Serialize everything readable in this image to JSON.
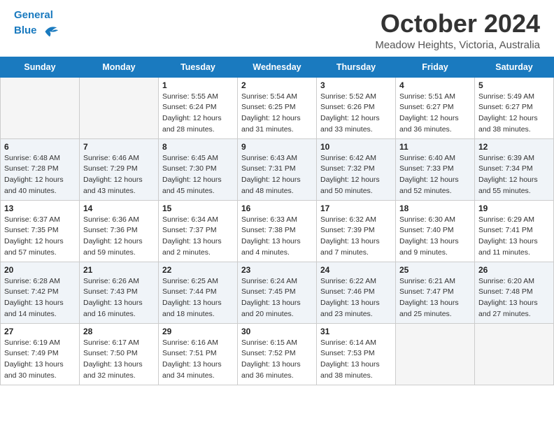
{
  "header": {
    "logo_line1": "General",
    "logo_line2": "Blue",
    "month_title": "October 2024",
    "location": "Meadow Heights, Victoria, Australia"
  },
  "days_of_week": [
    "Sunday",
    "Monday",
    "Tuesday",
    "Wednesday",
    "Thursday",
    "Friday",
    "Saturday"
  ],
  "weeks": [
    [
      {
        "day": "",
        "sunrise": "",
        "sunset": "",
        "daylight": "",
        "empty": true
      },
      {
        "day": "",
        "sunrise": "",
        "sunset": "",
        "daylight": "",
        "empty": true
      },
      {
        "day": "1",
        "sunrise": "Sunrise: 5:55 AM",
        "sunset": "Sunset: 6:24 PM",
        "daylight": "Daylight: 12 hours and 28 minutes.",
        "empty": false
      },
      {
        "day": "2",
        "sunrise": "Sunrise: 5:54 AM",
        "sunset": "Sunset: 6:25 PM",
        "daylight": "Daylight: 12 hours and 31 minutes.",
        "empty": false
      },
      {
        "day": "3",
        "sunrise": "Sunrise: 5:52 AM",
        "sunset": "Sunset: 6:26 PM",
        "daylight": "Daylight: 12 hours and 33 minutes.",
        "empty": false
      },
      {
        "day": "4",
        "sunrise": "Sunrise: 5:51 AM",
        "sunset": "Sunset: 6:27 PM",
        "daylight": "Daylight: 12 hours and 36 minutes.",
        "empty": false
      },
      {
        "day": "5",
        "sunrise": "Sunrise: 5:49 AM",
        "sunset": "Sunset: 6:27 PM",
        "daylight": "Daylight: 12 hours and 38 minutes.",
        "empty": false
      }
    ],
    [
      {
        "day": "6",
        "sunrise": "Sunrise: 6:48 AM",
        "sunset": "Sunset: 7:28 PM",
        "daylight": "Daylight: 12 hours and 40 minutes.",
        "empty": false
      },
      {
        "day": "7",
        "sunrise": "Sunrise: 6:46 AM",
        "sunset": "Sunset: 7:29 PM",
        "daylight": "Daylight: 12 hours and 43 minutes.",
        "empty": false
      },
      {
        "day": "8",
        "sunrise": "Sunrise: 6:45 AM",
        "sunset": "Sunset: 7:30 PM",
        "daylight": "Daylight: 12 hours and 45 minutes.",
        "empty": false
      },
      {
        "day": "9",
        "sunrise": "Sunrise: 6:43 AM",
        "sunset": "Sunset: 7:31 PM",
        "daylight": "Daylight: 12 hours and 48 minutes.",
        "empty": false
      },
      {
        "day": "10",
        "sunrise": "Sunrise: 6:42 AM",
        "sunset": "Sunset: 7:32 PM",
        "daylight": "Daylight: 12 hours and 50 minutes.",
        "empty": false
      },
      {
        "day": "11",
        "sunrise": "Sunrise: 6:40 AM",
        "sunset": "Sunset: 7:33 PM",
        "daylight": "Daylight: 12 hours and 52 minutes.",
        "empty": false
      },
      {
        "day": "12",
        "sunrise": "Sunrise: 6:39 AM",
        "sunset": "Sunset: 7:34 PM",
        "daylight": "Daylight: 12 hours and 55 minutes.",
        "empty": false
      }
    ],
    [
      {
        "day": "13",
        "sunrise": "Sunrise: 6:37 AM",
        "sunset": "Sunset: 7:35 PM",
        "daylight": "Daylight: 12 hours and 57 minutes.",
        "empty": false
      },
      {
        "day": "14",
        "sunrise": "Sunrise: 6:36 AM",
        "sunset": "Sunset: 7:36 PM",
        "daylight": "Daylight: 12 hours and 59 minutes.",
        "empty": false
      },
      {
        "day": "15",
        "sunrise": "Sunrise: 6:34 AM",
        "sunset": "Sunset: 7:37 PM",
        "daylight": "Daylight: 13 hours and 2 minutes.",
        "empty": false
      },
      {
        "day": "16",
        "sunrise": "Sunrise: 6:33 AM",
        "sunset": "Sunset: 7:38 PM",
        "daylight": "Daylight: 13 hours and 4 minutes.",
        "empty": false
      },
      {
        "day": "17",
        "sunrise": "Sunrise: 6:32 AM",
        "sunset": "Sunset: 7:39 PM",
        "daylight": "Daylight: 13 hours and 7 minutes.",
        "empty": false
      },
      {
        "day": "18",
        "sunrise": "Sunrise: 6:30 AM",
        "sunset": "Sunset: 7:40 PM",
        "daylight": "Daylight: 13 hours and 9 minutes.",
        "empty": false
      },
      {
        "day": "19",
        "sunrise": "Sunrise: 6:29 AM",
        "sunset": "Sunset: 7:41 PM",
        "daylight": "Daylight: 13 hours and 11 minutes.",
        "empty": false
      }
    ],
    [
      {
        "day": "20",
        "sunrise": "Sunrise: 6:28 AM",
        "sunset": "Sunset: 7:42 PM",
        "daylight": "Daylight: 13 hours and 14 minutes.",
        "empty": false
      },
      {
        "day": "21",
        "sunrise": "Sunrise: 6:26 AM",
        "sunset": "Sunset: 7:43 PM",
        "daylight": "Daylight: 13 hours and 16 minutes.",
        "empty": false
      },
      {
        "day": "22",
        "sunrise": "Sunrise: 6:25 AM",
        "sunset": "Sunset: 7:44 PM",
        "daylight": "Daylight: 13 hours and 18 minutes.",
        "empty": false
      },
      {
        "day": "23",
        "sunrise": "Sunrise: 6:24 AM",
        "sunset": "Sunset: 7:45 PM",
        "daylight": "Daylight: 13 hours and 20 minutes.",
        "empty": false
      },
      {
        "day": "24",
        "sunrise": "Sunrise: 6:22 AM",
        "sunset": "Sunset: 7:46 PM",
        "daylight": "Daylight: 13 hours and 23 minutes.",
        "empty": false
      },
      {
        "day": "25",
        "sunrise": "Sunrise: 6:21 AM",
        "sunset": "Sunset: 7:47 PM",
        "daylight": "Daylight: 13 hours and 25 minutes.",
        "empty": false
      },
      {
        "day": "26",
        "sunrise": "Sunrise: 6:20 AM",
        "sunset": "Sunset: 7:48 PM",
        "daylight": "Daylight: 13 hours and 27 minutes.",
        "empty": false
      }
    ],
    [
      {
        "day": "27",
        "sunrise": "Sunrise: 6:19 AM",
        "sunset": "Sunset: 7:49 PM",
        "daylight": "Daylight: 13 hours and 30 minutes.",
        "empty": false
      },
      {
        "day": "28",
        "sunrise": "Sunrise: 6:17 AM",
        "sunset": "Sunset: 7:50 PM",
        "daylight": "Daylight: 13 hours and 32 minutes.",
        "empty": false
      },
      {
        "day": "29",
        "sunrise": "Sunrise: 6:16 AM",
        "sunset": "Sunset: 7:51 PM",
        "daylight": "Daylight: 13 hours and 34 minutes.",
        "empty": false
      },
      {
        "day": "30",
        "sunrise": "Sunrise: 6:15 AM",
        "sunset": "Sunset: 7:52 PM",
        "daylight": "Daylight: 13 hours and 36 minutes.",
        "empty": false
      },
      {
        "day": "31",
        "sunrise": "Sunrise: 6:14 AM",
        "sunset": "Sunset: 7:53 PM",
        "daylight": "Daylight: 13 hours and 38 minutes.",
        "empty": false
      },
      {
        "day": "",
        "sunrise": "",
        "sunset": "",
        "daylight": "",
        "empty": true
      },
      {
        "day": "",
        "sunrise": "",
        "sunset": "",
        "daylight": "",
        "empty": true
      }
    ]
  ]
}
